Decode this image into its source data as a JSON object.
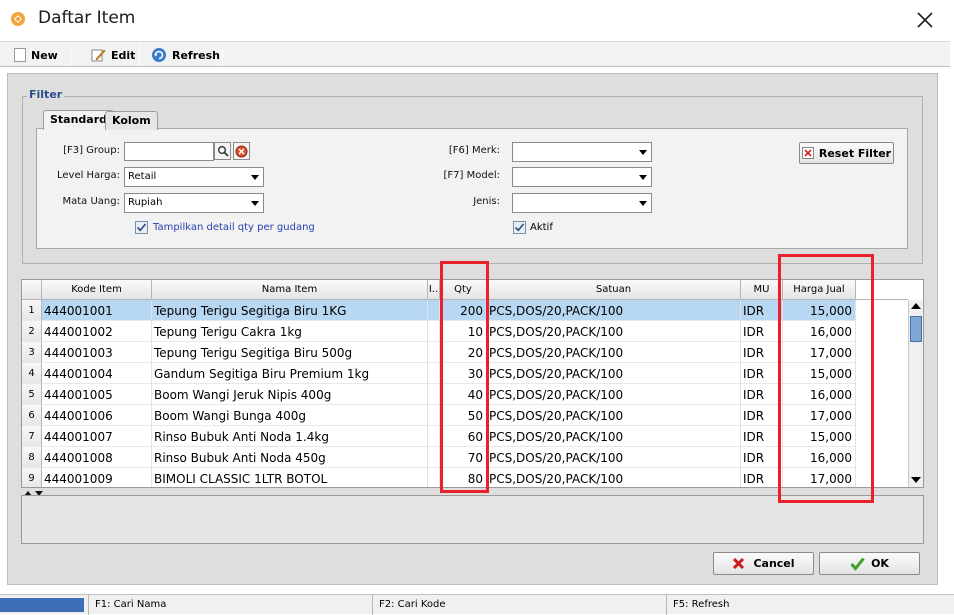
{
  "window": {
    "title": "Daftar Item",
    "close_symbol": "✕"
  },
  "toolbar": {
    "new_label": "New",
    "edit_label": "Edit",
    "refresh_label": "Refresh"
  },
  "filter": {
    "legend": "Filter",
    "tabs": [
      "Standard",
      "Kolom"
    ],
    "group_label": "[F3] Group:",
    "group_value": "",
    "level_harga_label": "Level Harga:",
    "level_harga_value": "Retail",
    "mata_uang_label": "Mata Uang:",
    "mata_uang_value": "Rupiah",
    "detail_qty_label": "Tampilkan detail qty per gudang",
    "detail_qty_checked": true,
    "merk_label": "[F6] Merk:",
    "merk_value": "",
    "model_label": "[F7] Model:",
    "model_value": "",
    "jenis_label": "Jenis:",
    "jenis_value": "",
    "aktif_label": "Aktif",
    "aktif_checked": true,
    "reset_label": "Reset Filter"
  },
  "grid": {
    "columns": [
      "Kode Item",
      "Nama Item",
      "I..",
      "Qty",
      "Satuan",
      "MU",
      "Harga Jual"
    ],
    "rows": [
      {
        "no": "1",
        "kode": "444001001",
        "nama": "Tepung Terigu Segitiga Biru 1KG",
        "qty": "200",
        "satuan": "PCS,DOS/20,PACK/100",
        "mu": "IDR",
        "harga": "15,000"
      },
      {
        "no": "2",
        "kode": "444001002",
        "nama": "Tepung Terigu Cakra 1kg",
        "qty": "10",
        "satuan": "PCS,DOS/20,PACK/100",
        "mu": "IDR",
        "harga": "16,000"
      },
      {
        "no": "3",
        "kode": "444001003",
        "nama": "Tepung Terigu Segitiga Biru 500g",
        "qty": "20",
        "satuan": "PCS,DOS/20,PACK/100",
        "mu": "IDR",
        "harga": "17,000"
      },
      {
        "no": "4",
        "kode": "444001004",
        "nama": "Gandum Segitiga Biru Premium 1kg",
        "qty": "30",
        "satuan": "PCS,DOS/20,PACK/100",
        "mu": "IDR",
        "harga": "15,000"
      },
      {
        "no": "5",
        "kode": "444001005",
        "nama": "Boom Wangi Jeruk Nipis 400g",
        "qty": "40",
        "satuan": "PCS,DOS/20,PACK/100",
        "mu": "IDR",
        "harga": "16,000"
      },
      {
        "no": "6",
        "kode": "444001006",
        "nama": "Boom Wangi Bunga 400g",
        "qty": "50",
        "satuan": "PCS,DOS/20,PACK/100",
        "mu": "IDR",
        "harga": "17,000"
      },
      {
        "no": "7",
        "kode": "444001007",
        "nama": "Rinso Bubuk Anti Noda 1.4kg",
        "qty": "60",
        "satuan": "PCS,DOS/20,PACK/100",
        "mu": "IDR",
        "harga": "15,000"
      },
      {
        "no": "8",
        "kode": "444001008",
        "nama": "Rinso Bubuk Anti Noda 450g",
        "qty": "70",
        "satuan": "PCS,DOS/20,PACK/100",
        "mu": "IDR",
        "harga": "16,000"
      },
      {
        "no": "9",
        "kode": "444001009",
        "nama": "BIMOLI CLASSIC 1LTR BOTOL",
        "qty": "80",
        "satuan": "PCS,DOS/20,PACK/100",
        "mu": "IDR",
        "harga": "17,000"
      }
    ],
    "selected_row": 1
  },
  "buttons": {
    "cancel_label": "Cancel",
    "ok_label": "OK"
  },
  "statusbar": {
    "f1": "F1: Cari Nama",
    "f2": "F2: Cari Kode",
    "f5": "F5: Refresh"
  },
  "highlight_color": "#e8222a"
}
